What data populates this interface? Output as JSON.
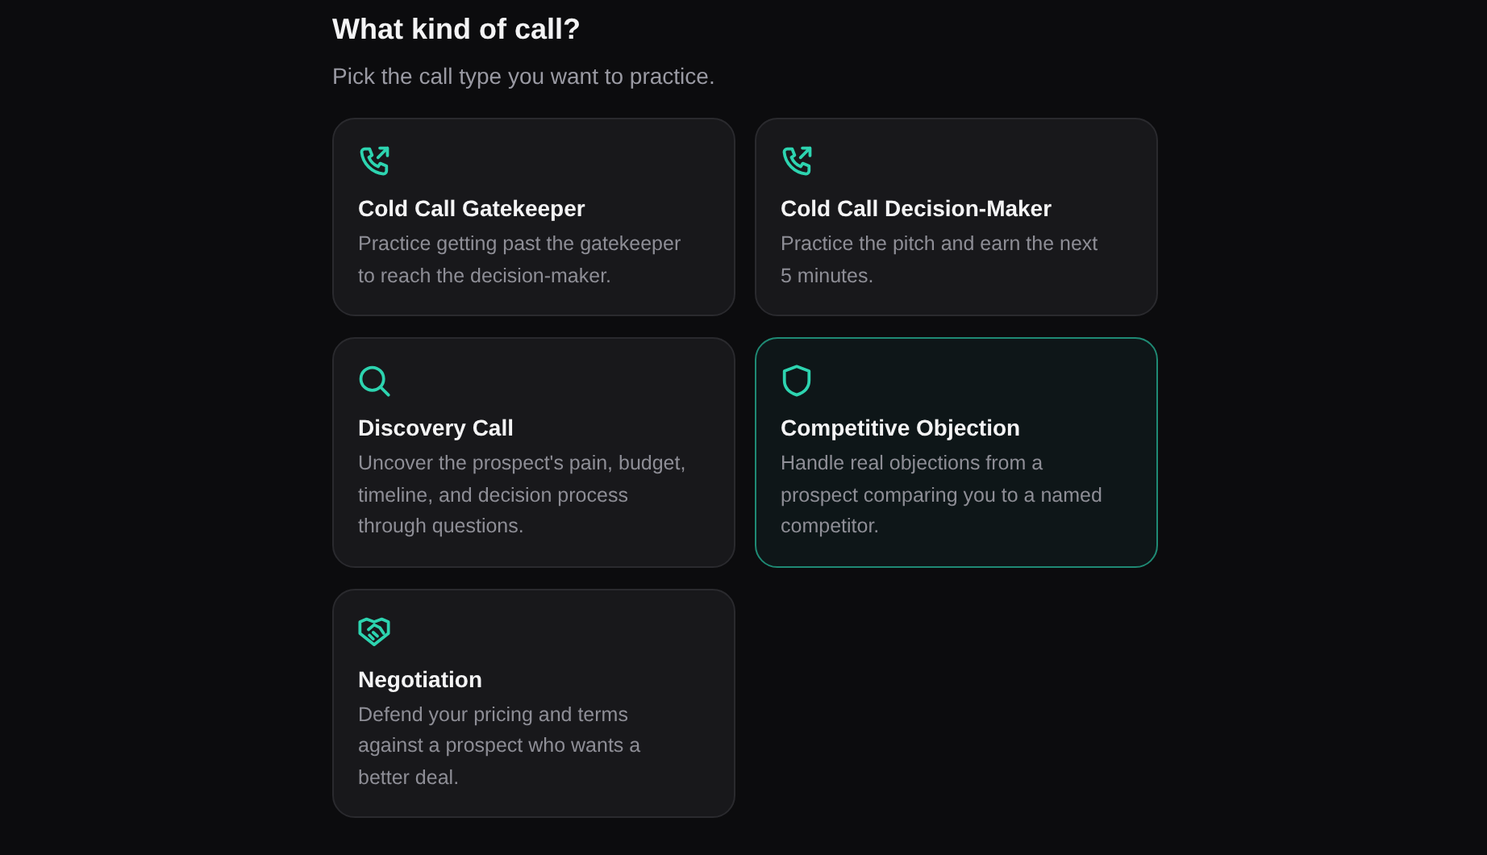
{
  "heading": "What kind of call?",
  "subheading": "Pick the call type you want to practice.",
  "call_types": [
    {
      "kind": "phone-outgoing",
      "title": "Cold Call Gatekeeper",
      "description": "Practice getting past the gatekeeper to reach the decision-maker.",
      "selected": false
    },
    {
      "kind": "phone-outgoing",
      "title": "Cold Call Decision-Maker",
      "description": "Practice the pitch and earn the next 5 minutes.",
      "selected": false
    },
    {
      "kind": "search",
      "title": "Discovery Call",
      "description": "Uncover the prospect's pain, budget, timeline, and decision process through questions.",
      "selected": false
    },
    {
      "kind": "shield",
      "title": "Competitive Objection",
      "description": "Handle real objections from a prospect comparing you to a named competitor.",
      "selected": true
    },
    {
      "kind": "handshake",
      "title": "Negotiation",
      "description": "Defend your pricing and terms against a prospect who wants a better deal.",
      "selected": false
    }
  ]
}
